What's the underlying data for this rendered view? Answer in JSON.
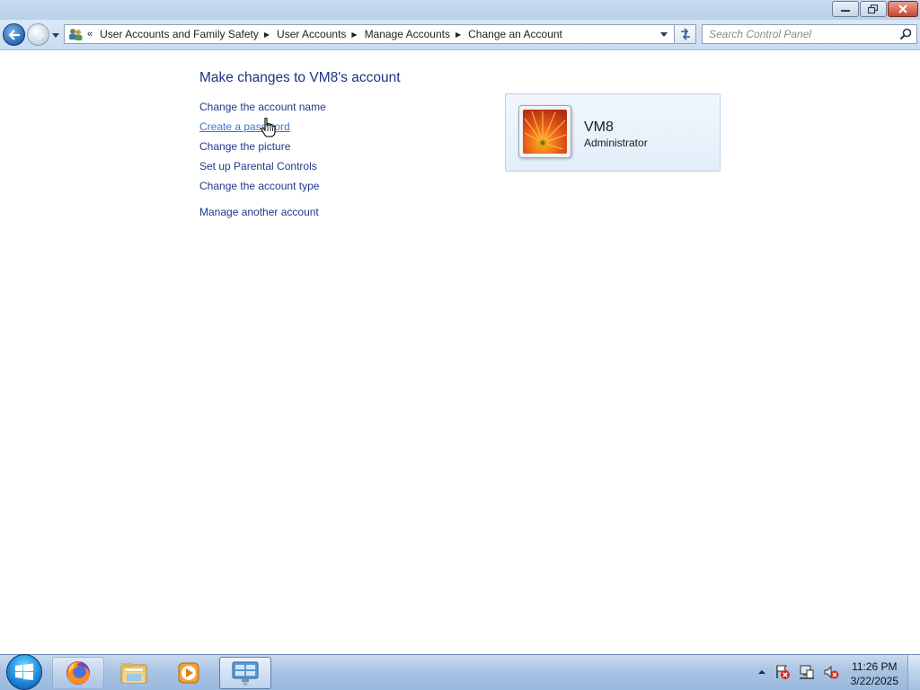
{
  "window": {
    "caption_buttons": [
      {
        "name": "minimize-button",
        "icon": "minimize-icon"
      },
      {
        "name": "restore-button",
        "icon": "restore-icon"
      },
      {
        "name": "close-button",
        "icon": "close-icon"
      }
    ]
  },
  "navigation": {
    "back_icon": "back-arrow-icon",
    "forward_icon": "forward-arrow-icon",
    "address_overflow": "«",
    "breadcrumbs": [
      "User Accounts and Family Safety",
      "User Accounts",
      "Manage Accounts",
      "Change an Account"
    ],
    "search_placeholder": "Search Control Panel"
  },
  "main": {
    "heading": "Make changes to VM8's account",
    "tasks": [
      "Change the account name",
      "Create a password",
      "Change the picture",
      "Set up Parental Controls",
      "Change the account type"
    ],
    "other_task": "Manage another account"
  },
  "account": {
    "name": "VM8",
    "role": "Administrator",
    "picture": "orange-flower-picture"
  },
  "taskbar": {
    "pinned": [
      "firefox-icon",
      "windows-explorer-icon",
      "media-player-icon",
      "control-panel-icon"
    ],
    "tray_icons": [
      "show-hidden-icons-arrow",
      "action-center-icon",
      "network-icon",
      "volume-muted-icon"
    ],
    "time": "11:26 PM",
    "date": "3/22/2025"
  },
  "colors": {
    "link": "#1e3a8a",
    "heading": "#1e3287",
    "hover_link": "#3c76c8"
  }
}
